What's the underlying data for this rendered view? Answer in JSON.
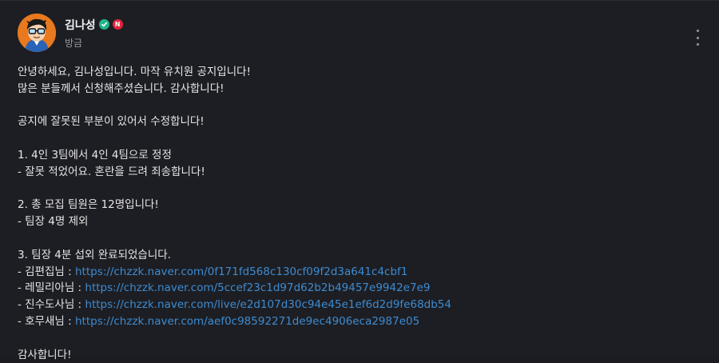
{
  "author": {
    "name": "김나성",
    "time": "방금",
    "badge": "N"
  },
  "icons": {
    "verified": "verified-check-icon",
    "partner": "naver-n-badge-icon",
    "more": "more-vertical-icon"
  },
  "colors": {
    "background": "#1d1e23",
    "link": "#3d8bd1",
    "verified": "#20b58a",
    "badge": "#e0263b",
    "avatar_bg": "#e8791f"
  },
  "body": {
    "l1": "안녕하세요, 김나성입니다. 마작 유치원 공지입니다!",
    "l2": "많은 분들께서 신청해주셨습니다. 감사합니다!",
    "l3": "공지에 잘못된 부분이 있어서 수정합니다!",
    "l4": "1. 4인 3팀에서 4인 4팀으로 정정",
    "l5": "- 잘못 적었어요. 혼란을 드려 죄송합니다!",
    "l6": "2. 총 모집 팀원은 12명입니다!",
    "l7": "- 팀장 4명 제외",
    "l8": "3. 팀장 4분 섭외 완료되었습니다.",
    "leaders": [
      {
        "label": "- 김편집님 : ",
        "url": "https://chzzk.naver.com/0f171fd568c130cf09f2d3a641c4cbf1"
      },
      {
        "label": "- 레밀리아님 : ",
        "url": "https://chzzk.naver.com/5ccef23c1d97d62b2b49457e9942e7e9"
      },
      {
        "label": "- 진수도사님 : ",
        "url": "https://chzzk.naver.com/live/e2d107d30c94e45e1ef6d2d9fe68db54"
      },
      {
        "label": "- 호무새님 : ",
        "url": "https://chzzk.naver.com/aef0c98592271de9ec4906eca2987e05"
      }
    ],
    "closing": "감사합니다!"
  }
}
